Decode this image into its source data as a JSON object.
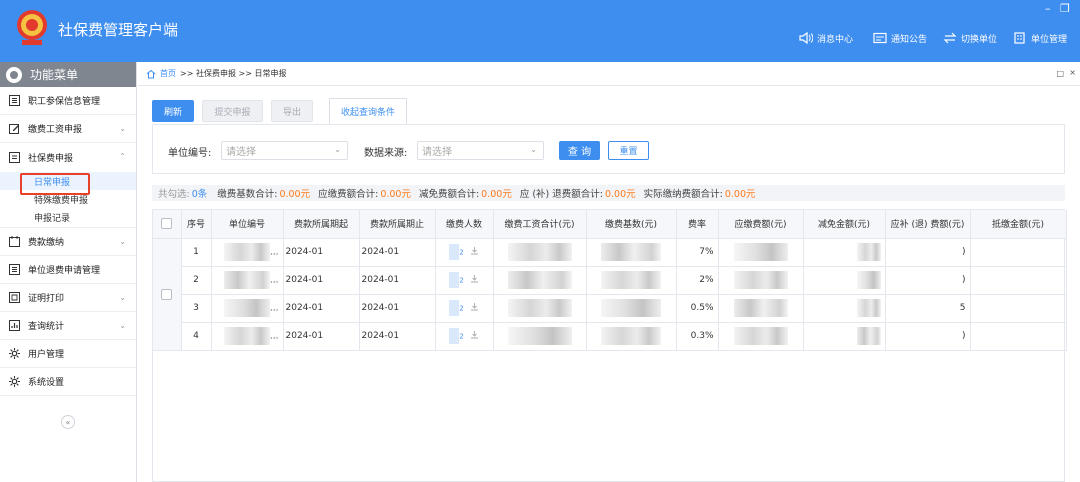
{
  "app": {
    "title": "社保费管理客户端"
  },
  "window": {
    "minimize": "–",
    "restore": "❐"
  },
  "top_nav": [
    {
      "label": "消息中心",
      "icon": "speaker-icon"
    },
    {
      "label": "通知公告",
      "icon": "notice-icon"
    },
    {
      "label": "切换单位",
      "icon": "switch-icon"
    },
    {
      "label": "单位管理",
      "icon": "building-icon"
    }
  ],
  "sidebar": {
    "header": "功能菜单",
    "items": [
      {
        "label": "职工参保信息管理"
      },
      {
        "label": "缴费工资申报",
        "chevron": "⌄"
      },
      {
        "label": "社保费申报",
        "chevron": "⌃"
      },
      {
        "label": "费款缴纳",
        "chevron": "⌄"
      },
      {
        "label": "单位退费申请管理"
      },
      {
        "label": "证明打印",
        "chevron": "⌄"
      },
      {
        "label": "查询统计",
        "chevron": "⌄"
      },
      {
        "label": "用户管理"
      },
      {
        "label": "系统设置"
      }
    ],
    "sub_items": [
      {
        "label": "日常申报"
      },
      {
        "label": "特殊缴费申报"
      },
      {
        "label": "申报记录"
      }
    ],
    "collapse": "«"
  },
  "breadcrumb": {
    "home": "首页",
    "path": ">> 社保费申报 >> 日常申报",
    "pin": "□",
    "close": "×"
  },
  "toolbar": {
    "refresh": "刷新",
    "submit": "提交申报",
    "export": "导出",
    "query_tab": "收起查询条件"
  },
  "filter": {
    "unit_code_label": "单位编号:",
    "unit_code_placeholder": "请选择",
    "data_source_label": "数据来源:",
    "data_source_placeholder": "请选择",
    "query_button": "查 询",
    "reset_button": "重置"
  },
  "summary": {
    "selected_label": "共勾选:",
    "selected_count": "0条",
    "base_total_label": "缴费基数合计:",
    "base_total": "0.00元",
    "due_total_label": "应缴费额合计:",
    "due_total": "0.00元",
    "relief_total_label": "减免费额合计:",
    "relief_total": "0.00元",
    "refund_total_label": "应 (补) 退费额合计:",
    "refund_total": "0.00元",
    "actual_total_label": "实际缴纳费额合计:",
    "actual_total": "0.00元"
  },
  "table": {
    "headers": [
      "序号",
      "单位编号",
      "费款所属期起",
      "费款所属期止",
      "缴费人数",
      "缴费工资合计(元)",
      "缴费基数(元)",
      "费率",
      "应缴费额(元)",
      "减免金额(元)",
      "应补 (退) 费额(元)",
      "抵缴金额(元)"
    ],
    "rows": [
      {
        "no": "1",
        "unit": "...",
        "start": "2024-01",
        "end": "2024-01",
        "count": "2",
        "rate": "7%",
        "refund": ")"
      },
      {
        "no": "2",
        "unit": "...",
        "start": "2024-01",
        "end": "2024-01",
        "count": "2",
        "rate": "2%",
        "refund": ")"
      },
      {
        "no": "3",
        "unit": "...",
        "start": "2024-01",
        "end": "2024-01",
        "count": "2",
        "rate": "0.5%",
        "refund": "5"
      },
      {
        "no": "4",
        "unit": "...",
        "start": "2024-01",
        "end": "2024-01",
        "count": "2",
        "rate": "0.3%",
        "refund": ")"
      }
    ]
  },
  "colors": {
    "primary": "#3e8ef0",
    "orange": "#ff7a1a",
    "highlight_border": "#e8412b",
    "menu_header": "#7f8690"
  }
}
